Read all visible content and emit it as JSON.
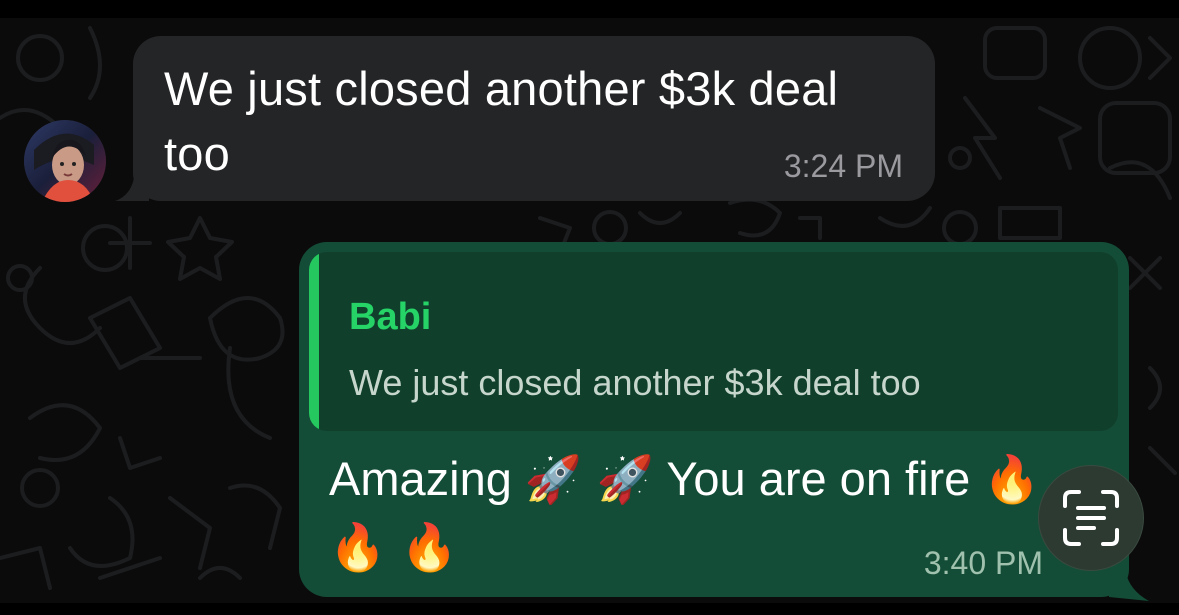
{
  "messages": {
    "incoming": {
      "text": "We just closed another $3k deal too",
      "time": "3:24 PM",
      "avatar_icon": "contact-avatar"
    },
    "outgoing": {
      "quoted": {
        "author": "Babi",
        "text": "We just closed another $3k deal too"
      },
      "text_part1": "Amazing",
      "emoji_rockets": "🚀 🚀",
      "text_part2": "You are on fire",
      "emoji_fires": "🔥 🔥 🔥",
      "time": "3:40 PM"
    }
  },
  "live_text_button": {
    "icon": "live-text-scan-icon"
  },
  "colors": {
    "background": "#0b0b0c",
    "incoming_bubble": "#242526",
    "outgoing_bubble": "#144d37",
    "quote_bubble": "#103f2c",
    "quote_accent": "#25c85f",
    "author_name": "#25d366"
  }
}
